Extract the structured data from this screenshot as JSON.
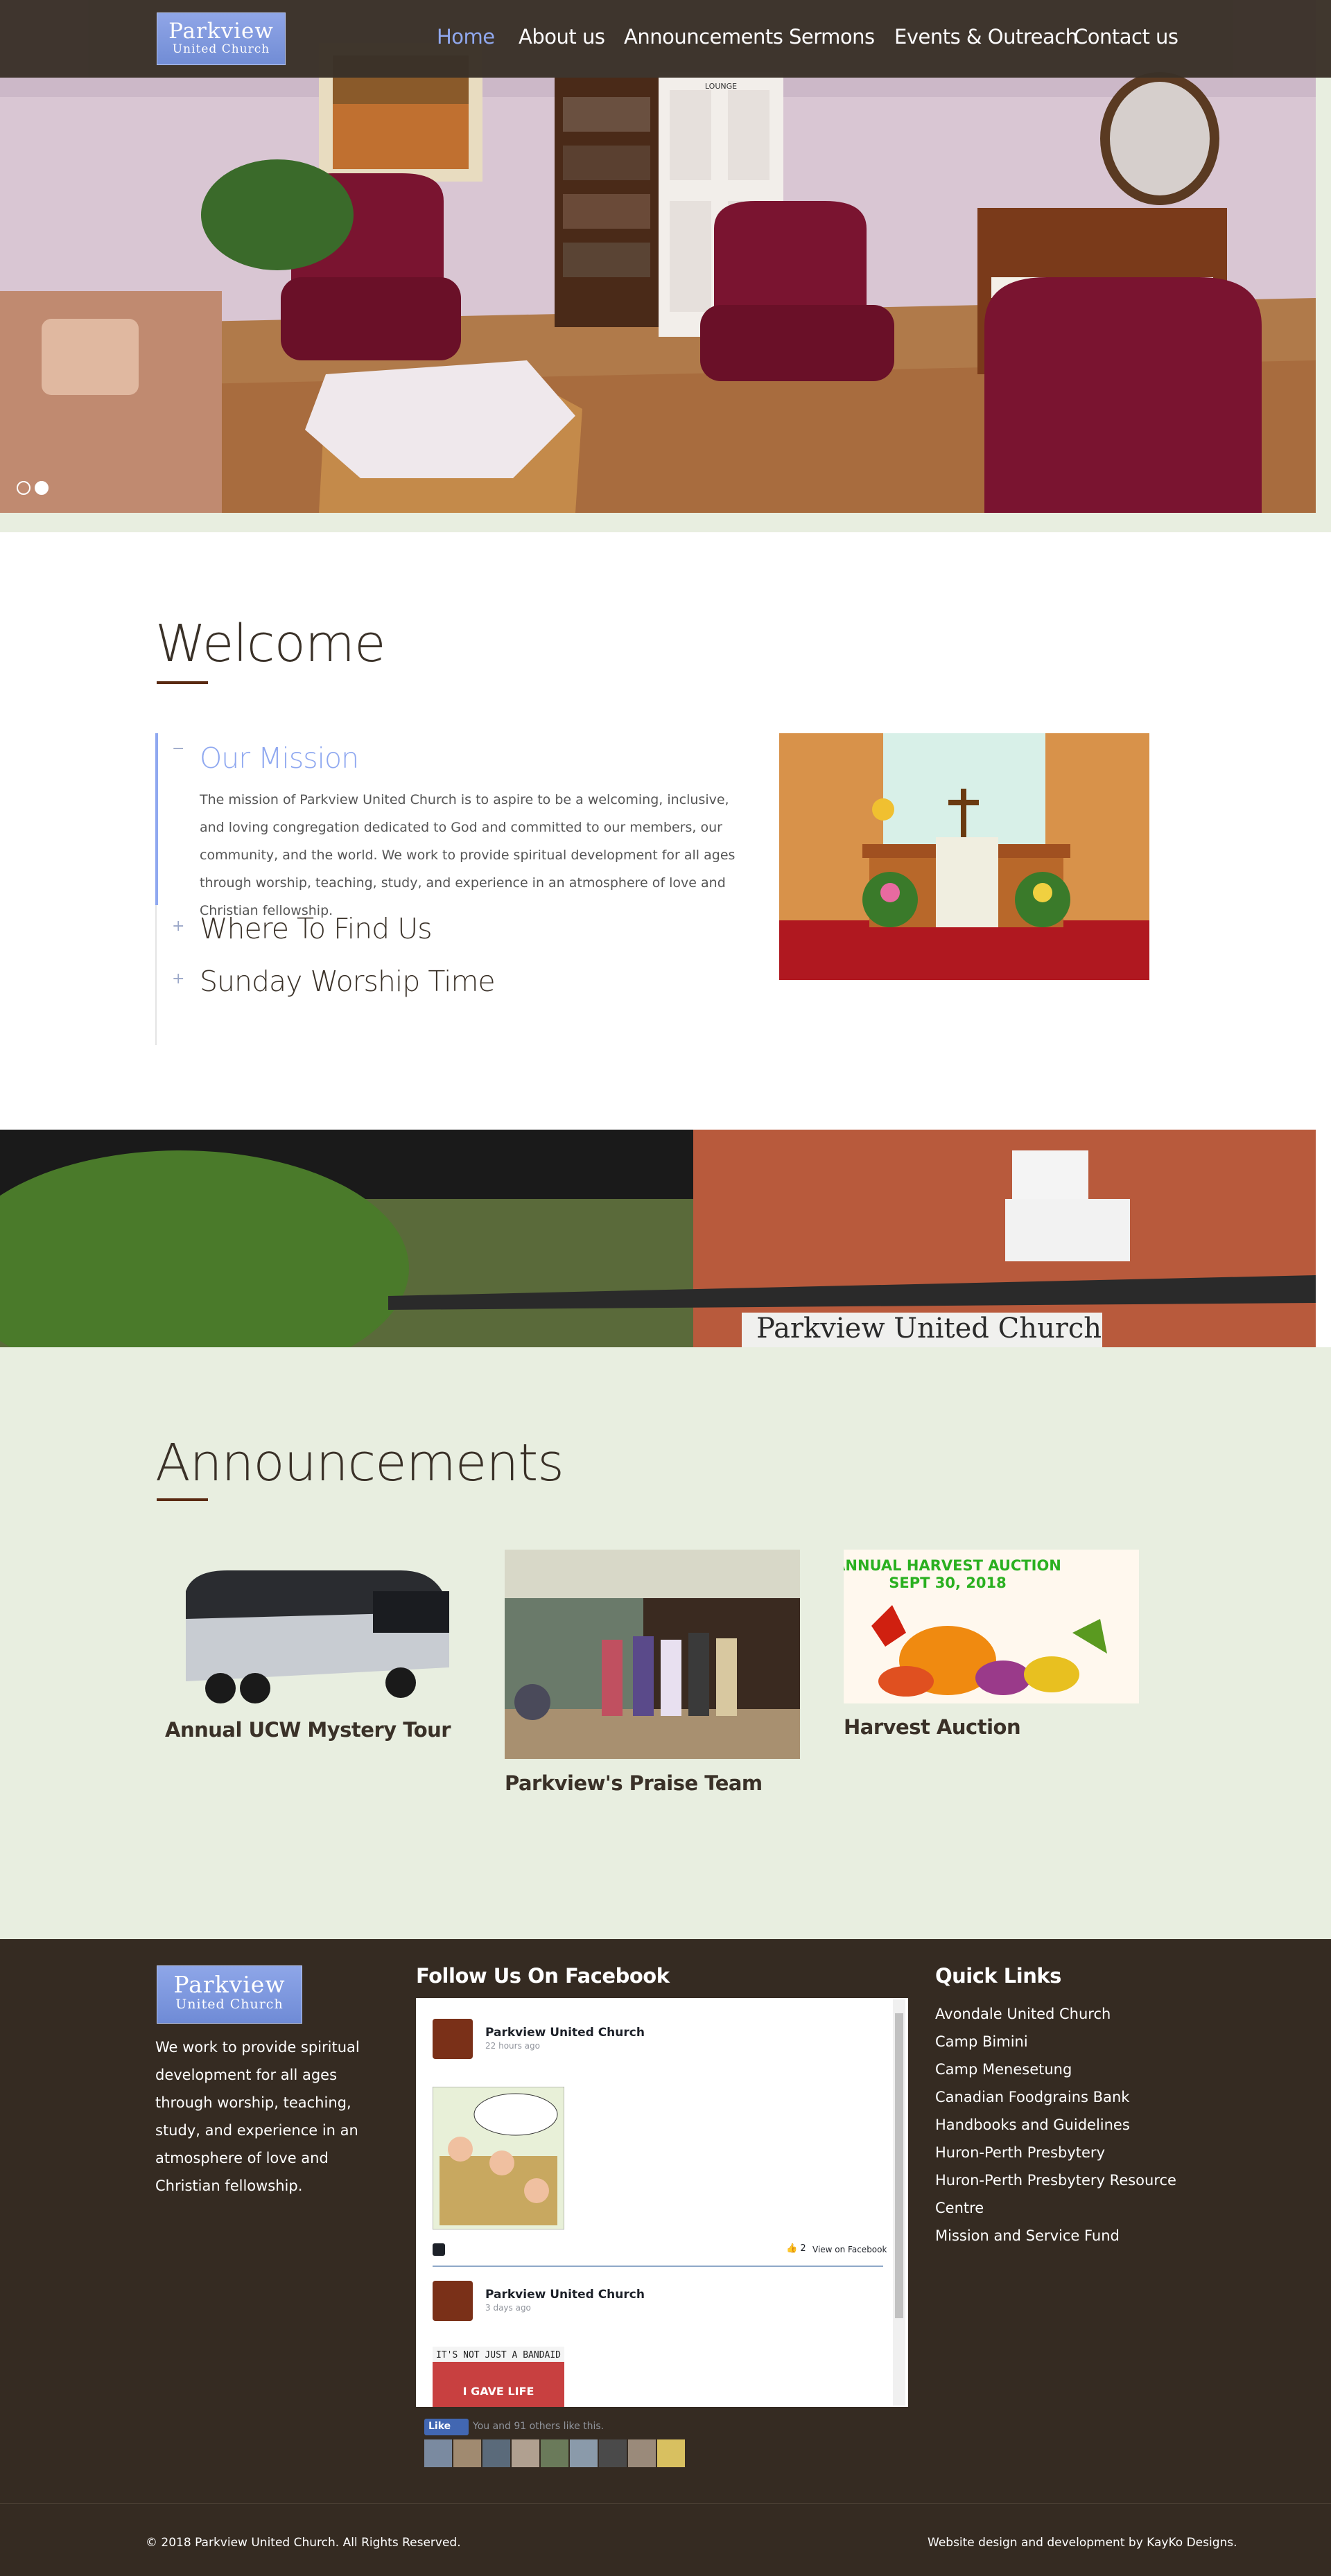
{
  "brand": {
    "name_line1": "Parkview",
    "name_line2": "United Church"
  },
  "nav": {
    "items": [
      {
        "label": "Home",
        "active": true
      },
      {
        "label": "About us",
        "active": false
      },
      {
        "label": "Announcements",
        "active": false
      },
      {
        "label": "Sermons",
        "active": false
      },
      {
        "label": "Events & Outreach",
        "active": false
      },
      {
        "label": "Contact us",
        "active": false
      }
    ]
  },
  "hero": {
    "slide_count": 2,
    "active_slide": 2,
    "door_sign": "LOUNGE"
  },
  "welcome": {
    "title": "Welcome",
    "accordion": [
      {
        "toggle": "−",
        "title": "Our Mission",
        "expanded": true,
        "text": "The mission of Parkview United Church is to aspire to be a welcoming, inclusive, and loving congregation dedicated to God and committed to our members, our community, and the world. We work to provide spiritual development for all ages through worship, teaching, study, and experience in an atmosphere of love and Christian fellowship."
      },
      {
        "toggle": "+",
        "title": "Where To Find Us",
        "expanded": false
      },
      {
        "toggle": "+",
        "title": "Sunday Worship Time",
        "expanded": false
      }
    ]
  },
  "building": {
    "sign_text": "Parkview United Church"
  },
  "announcements": {
    "title": "Announcements",
    "items": [
      {
        "title": "Annual UCW Mystery Tour"
      },
      {
        "title": "Parkview's Praise Team"
      },
      {
        "title": "Harvest Auction",
        "image_text_line1": "ANNUAL HARVEST AUCTION",
        "image_text_line2": "SEPT 30, 2018"
      }
    ]
  },
  "footer": {
    "about_text": "We work to provide spiritual development for all ages through worship, teaching, study, and experience in an atmosphere of love and Christian fellowship.",
    "facebook_heading": "Follow Us On Facebook",
    "facebook": {
      "posts": [
        {
          "author": "Parkview United Church",
          "time": "22 hours ago",
          "likes": "2",
          "view_link": "View on Facebook"
        },
        {
          "author": "Parkview United Church",
          "time": "3 days ago",
          "banner_top": "IT'S NOT JUST A BANDAID",
          "banner_bottom": "I GAVE LIFE"
        }
      ],
      "like_button": "Like",
      "like_text": "You and 91 others like this."
    },
    "quick_links_heading": "Quick Links",
    "quick_links": [
      "Avondale United Church",
      "Camp Bimini",
      "Camp Menesetung",
      "Canadian Foodgrains Bank",
      "Handbooks and Guidelines",
      "Huron-Perth Presbytery",
      "Huron-Perth Presbytery Resource",
      "Centre",
      "Mission and Service Fund"
    ],
    "copyright": "© 2018 Parkview United Church. All Rights Reserved.",
    "credit": "Website design and development by KayKo Designs."
  },
  "colors": {
    "header_bg": "#3a3128",
    "accent_blue": "#8fa8f0",
    "footer_bg": "#352b22",
    "section_bg": "#e8eee0",
    "title_underline": "#5a2a12"
  }
}
